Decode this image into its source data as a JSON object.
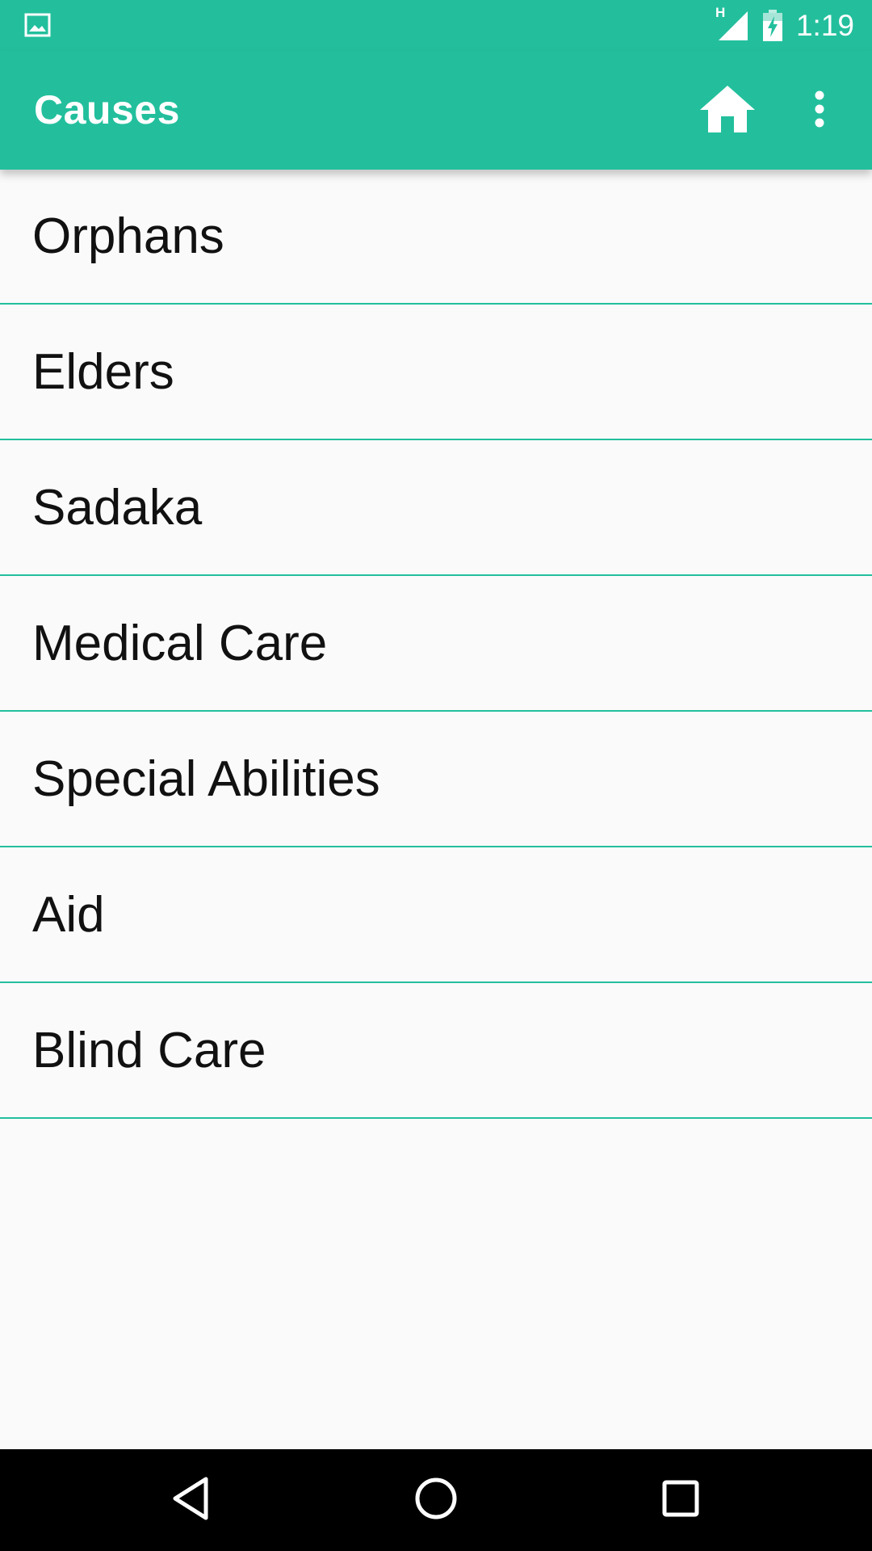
{
  "status_bar": {
    "time": "1:19",
    "network_label": "H",
    "icons": [
      "image-notification-icon",
      "signal-icon",
      "battery-charging-icon"
    ]
  },
  "app_bar": {
    "title": "Causes",
    "actions": [
      "home-icon",
      "overflow-menu-icon"
    ]
  },
  "causes": {
    "items": [
      {
        "label": "Orphans"
      },
      {
        "label": "Elders"
      },
      {
        "label": "Sadaka"
      },
      {
        "label": "Medical Care"
      },
      {
        "label": "Special Abilities"
      },
      {
        "label": "Aid"
      },
      {
        "label": "Blind Care"
      }
    ]
  },
  "nav_bar": {
    "buttons": [
      "back-icon",
      "home-circle-icon",
      "recents-icon"
    ]
  },
  "colors": {
    "primary": "#23bf9d",
    "divider": "#23bf9d",
    "background": "#fafafa",
    "text": "#111111",
    "nav_bar": "#000000"
  }
}
